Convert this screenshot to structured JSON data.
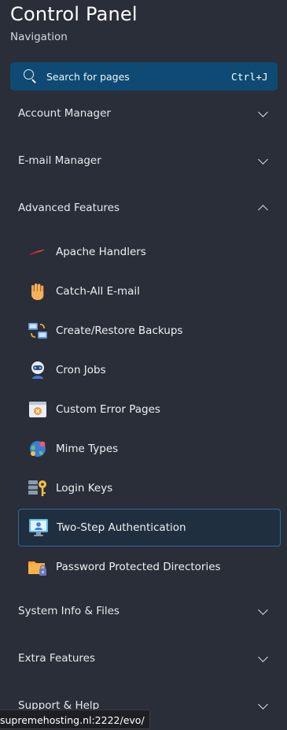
{
  "header": {
    "title": "Control Panel",
    "subtitle": "Navigation"
  },
  "search": {
    "placeholder": "Search for pages",
    "shortcut": "Ctrl+J"
  },
  "sections": {
    "account_manager": {
      "label": "Account Manager",
      "expanded": false
    },
    "email_manager": {
      "label": "E-mail Manager",
      "expanded": false
    },
    "advanced_features": {
      "label": "Advanced Features",
      "expanded": true,
      "items": [
        {
          "label": "Apache Handlers",
          "icon": "apache-feather-icon"
        },
        {
          "label": "Catch-All E-mail",
          "icon": "raised-hand-icon"
        },
        {
          "label": "Create/Restore Backups",
          "icon": "backup-sync-icon"
        },
        {
          "label": "Cron Jobs",
          "icon": "robot-icon"
        },
        {
          "label": "Custom Error Pages",
          "icon": "error-page-icon"
        },
        {
          "label": "Mime Types",
          "icon": "globe-icon"
        },
        {
          "label": "Login Keys",
          "icon": "key-icon"
        },
        {
          "label": "Two-Step Authentication",
          "icon": "monitor-user-icon",
          "active": true
        },
        {
          "label": "Password Protected Directories",
          "icon": "locked-folder-icon"
        }
      ]
    },
    "system_info": {
      "label": "System Info & Files",
      "expanded": false
    },
    "extra_features": {
      "label": "Extra Features",
      "expanded": false
    },
    "support_help": {
      "label": "Support & Help",
      "expanded": false
    }
  },
  "status_bar": {
    "url": "supremehosting.nl:2222/evo/"
  },
  "colors": {
    "background": "#2a2e38",
    "search_bg": "#0e4a73",
    "active_border": "#2f6c93"
  }
}
